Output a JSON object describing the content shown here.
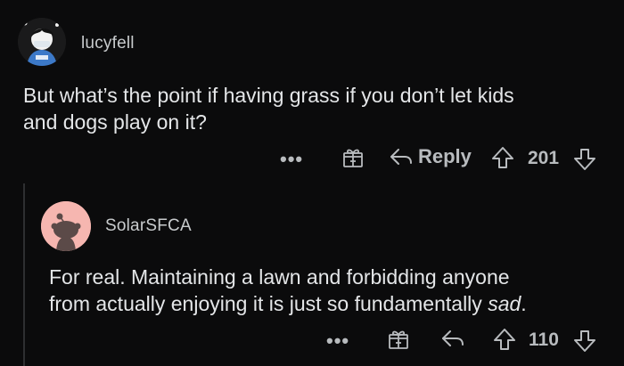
{
  "comments": [
    {
      "username": "lucyfell",
      "text_lines": [
        "But what’s the point if having grass if you don’t let kids",
        "and dogs play on it?"
      ],
      "actions": {
        "more": "•••",
        "reply_label": "Reply",
        "score": "201"
      }
    },
    {
      "username": "SolarSFCA",
      "text_lines": [
        "For real.  Maintaining a lawn and forbidding anyone",
        "from actually enjoying it is just so fundamentally "
      ],
      "text_emphasis": "sad",
      "text_end": ".",
      "actions": {
        "more": "•••",
        "score": "110"
      }
    }
  ],
  "colors": {
    "background": "#0b0b0c",
    "text": "#e4e6e8",
    "muted": "#b8bbbe",
    "avatar_pink": "#f6b6b0"
  },
  "icons": [
    "gift-icon",
    "reply-arrow-icon",
    "upvote-icon",
    "downvote-icon"
  ]
}
